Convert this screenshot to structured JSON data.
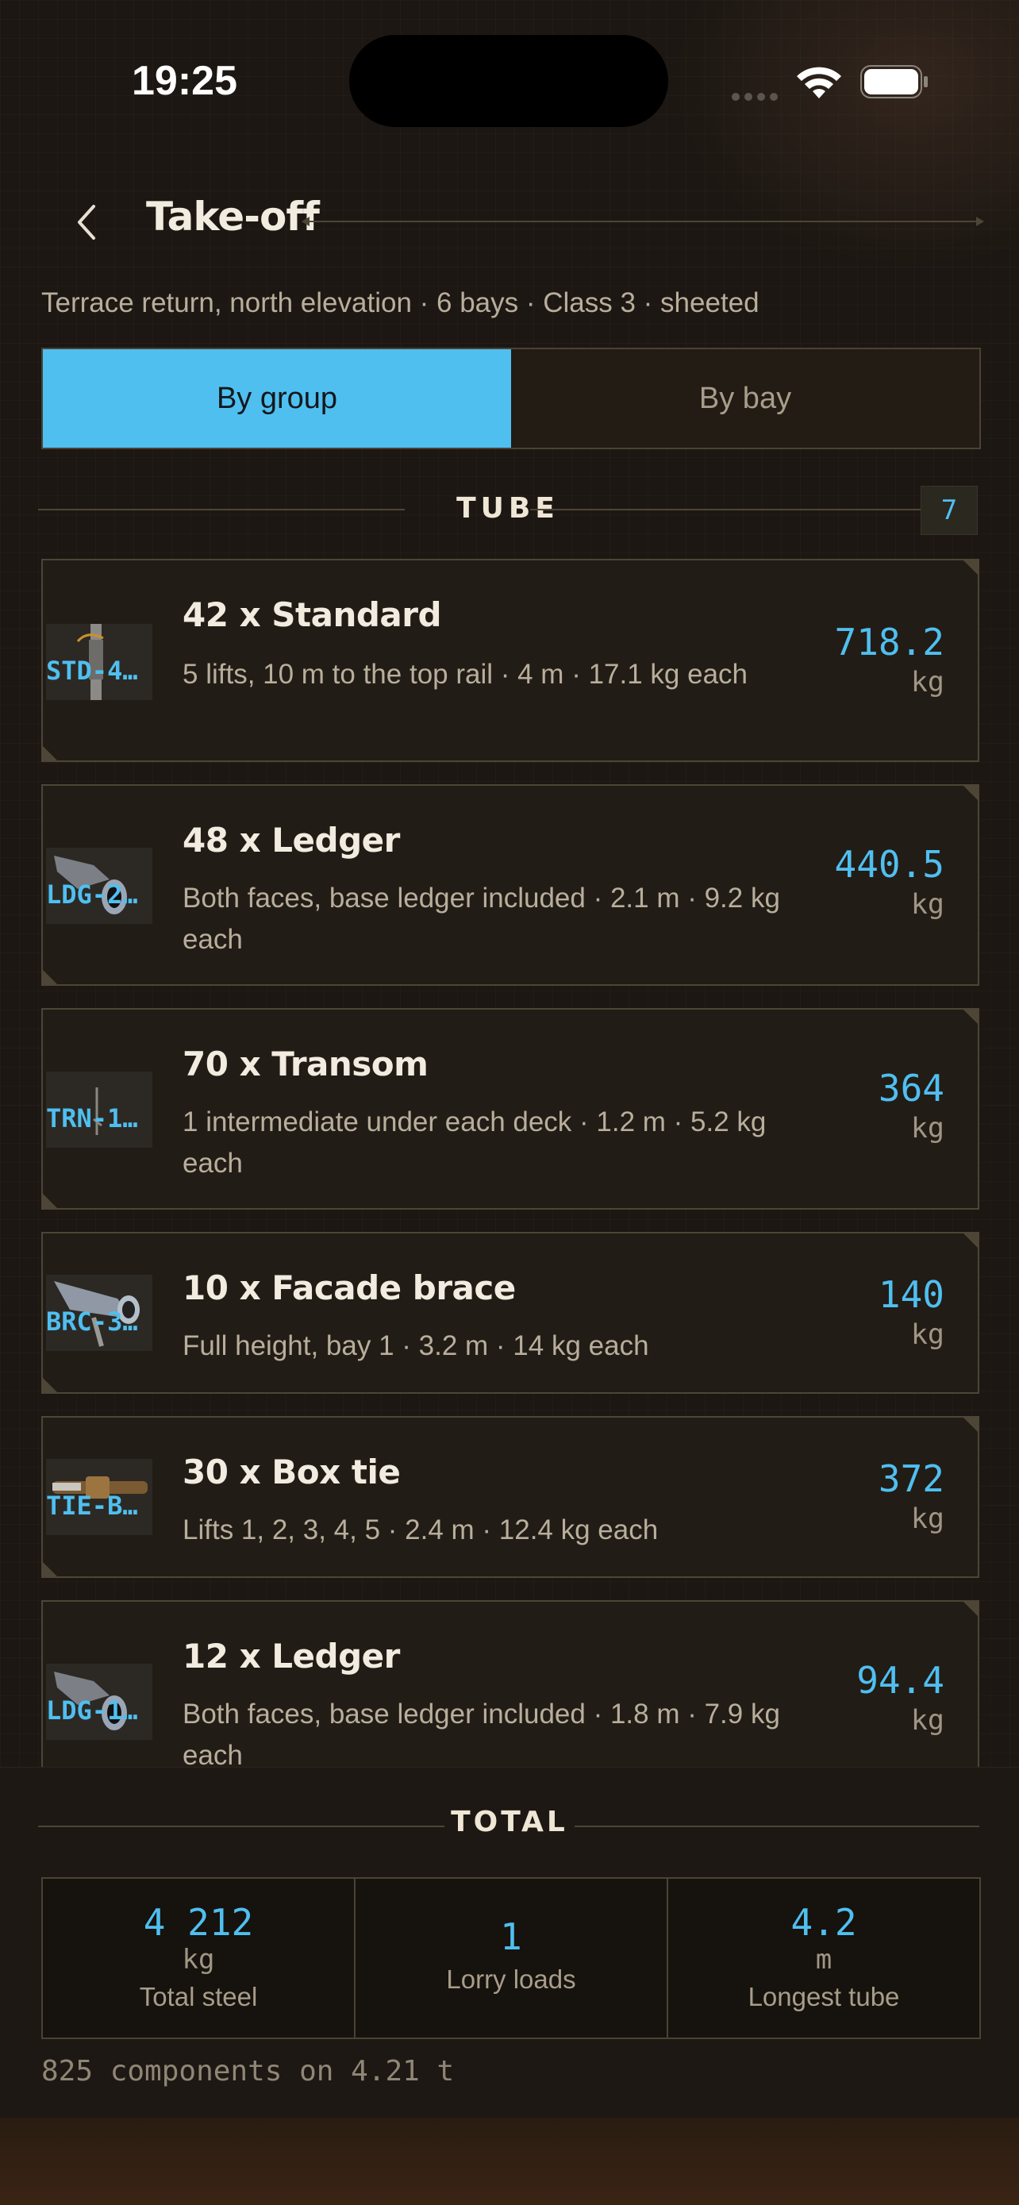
{
  "status_bar": {
    "time": "19:25"
  },
  "header": {
    "title": "Take-off"
  },
  "subtitle": "Terrace return, north elevation  ·  6 bays  ·  Class 3  ·  sheeted",
  "segmented": {
    "by_group": "By group",
    "by_bay": "By bay",
    "selected": "By group"
  },
  "section": {
    "title": "TUBE",
    "count": "7"
  },
  "items": [
    {
      "code": "STD-4…",
      "name": "42 x Standard",
      "desc": "5 lifts, 10 m to the top rail  ·  4 m  ·  17.1 kg each",
      "value": "718.2",
      "unit": "kg"
    },
    {
      "code": "LDG-2…",
      "name": "48 x Ledger",
      "desc": "Both faces, base ledger included  ·  2.1 m  ·  9.2 kg each",
      "value": "440.5",
      "unit": "kg"
    },
    {
      "code": "TRN-1…",
      "name": "70 x Transom",
      "desc": "1 intermediate under each deck  ·  1.2 m  ·  5.2 kg each",
      "value": "364",
      "unit": "kg"
    },
    {
      "code": "BRC-3…",
      "name": "10 x Facade brace",
      "desc": "Full height, bay 1  ·  3.2 m  ·  14 kg each",
      "value": "140",
      "unit": "kg"
    },
    {
      "code": "TIE-B…",
      "name": "30 x Box tie",
      "desc": "Lifts 1, 2, 3, 4, 5  ·  2.4 m  ·  12.4 kg each",
      "value": "372",
      "unit": "kg"
    },
    {
      "code": "LDG-1…",
      "name": "12 x Ledger",
      "desc": "Both faces, base ledger included  ·  1.8 m  ·  7.9 kg each",
      "value": "94.4",
      "unit": "kg"
    }
  ],
  "total": {
    "title": "TOTAL",
    "steel_value": "4 212",
    "steel_unit": "kg",
    "steel_label": "Total steel",
    "lorry_value": "1",
    "lorry_label": "Lorry loads",
    "tube_value": "4.2",
    "tube_unit": "m",
    "tube_label": "Longest tube",
    "footnote": "825 components on 4.21 t"
  },
  "colors": {
    "accent": "#4fbff0",
    "background": "#1c1712",
    "border": "#4d4536"
  }
}
